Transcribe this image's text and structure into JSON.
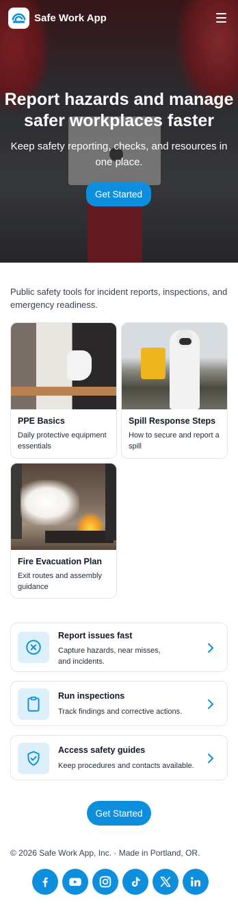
{
  "header": {
    "brand": "Safe Work App"
  },
  "hero": {
    "title": "Report hazards and manage safer workplaces faster",
    "subtitle": "Keep safety reporting, checks, and resources in one place.",
    "cta": "Get Started"
  },
  "intro": "Public safety tools for incident reports, inspections, and emergency readiness.",
  "cards": [
    {
      "title": "PPE Basics",
      "desc": "Daily protective equipment essentials"
    },
    {
      "title": "Spill Response Steps",
      "desc": "How to secure and report a spill"
    },
    {
      "title": "Fire Evacuation Plan",
      "desc": "Exit routes and assembly guidance"
    }
  ],
  "features": [
    {
      "title": "Report issues fast",
      "desc": "Capture hazards, near misses, and incidents.",
      "icon": "x-circle-icon"
    },
    {
      "title": "Run inspections",
      "desc": "Track findings and corrective actions.",
      "icon": "clipboard-icon"
    },
    {
      "title": "Access safety guides",
      "desc": "Keep procedures and contacts available.",
      "icon": "shield-check-icon"
    }
  ],
  "footer": {
    "cta": "Get Started",
    "copyright": "© 2026 Safe Work App, Inc. · Made in Portland, OR.",
    "socials": [
      "facebook-icon",
      "youtube-icon",
      "instagram-icon",
      "tiktok-icon",
      "x-icon",
      "linkedin-icon"
    ]
  },
  "colors": {
    "accent": "#0d8fde",
    "icon_bg": "#ddeff9",
    "border": "#e3e5e8"
  }
}
